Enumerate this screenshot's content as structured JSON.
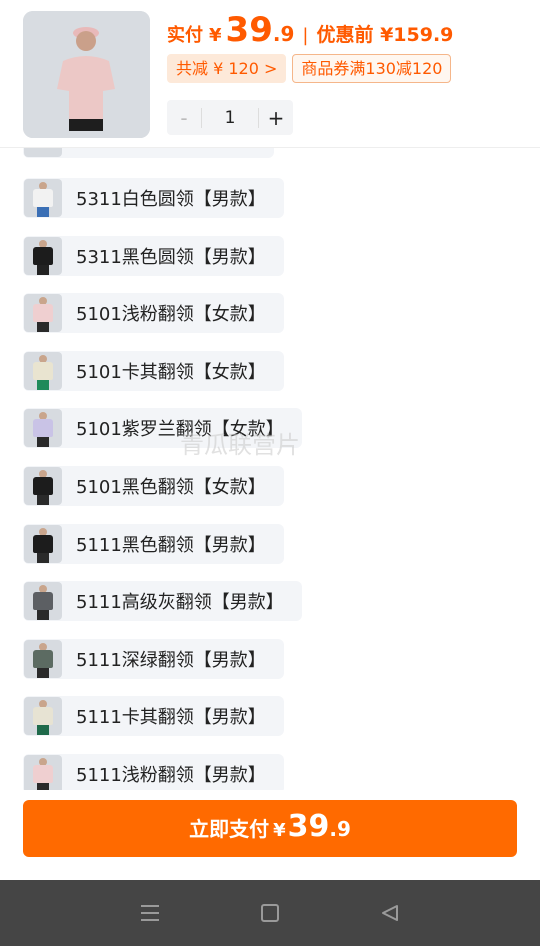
{
  "header": {
    "price_label": "实付",
    "currency": "¥",
    "price_int": "39",
    "price_dec": ".9",
    "separator": "|",
    "original_label": "优惠前 ¥159.9",
    "discount_tag": "共减 ¥ 120 >",
    "coupon_tag": "商品券满130减120",
    "quantity": {
      "minus": "-",
      "value": "1",
      "plus": "+"
    }
  },
  "options": [
    {
      "label": "5311白色圆领【男款】",
      "shirt": "#f2f2f2",
      "legs": "#3b6fb5"
    },
    {
      "label": "5311黑色圆领【男款】",
      "shirt": "#1c1c1c",
      "legs": "#222222"
    },
    {
      "label": "5101浅粉翻领【女款】",
      "shirt": "#efcfd0",
      "legs": "#2a2a2a"
    },
    {
      "label": "5101卡其翻领【女款】",
      "shirt": "#e9e4d0",
      "legs": "#1f8a5a"
    },
    {
      "label": "5101紫罗兰翻领【女款】",
      "shirt": "#c9c3e6",
      "legs": "#2a2a2a"
    },
    {
      "label": "5101黑色翻领【女款】",
      "shirt": "#1c1c1c",
      "legs": "#2a2a2a"
    },
    {
      "label": "5111黑色翻领【男款】",
      "shirt": "#1c1c1c",
      "legs": "#2a2a2a"
    },
    {
      "label": "5111高级灰翻领【男款】",
      "shirt": "#5c5f63",
      "legs": "#2a2a2a"
    },
    {
      "label": "5111深绿翻领【男款】",
      "shirt": "#5c6b62",
      "legs": "#2a2a2a"
    },
    {
      "label": "5111卡其翻领【男款】",
      "shirt": "#e7e3d3",
      "legs": "#1f6a4a"
    },
    {
      "label": "5111浅粉翻领【男款】",
      "shirt": "#efcfd0",
      "legs": "#2a2a2a"
    }
  ],
  "watermark": "青瓜联营片",
  "pay_button": {
    "label": "立即支付",
    "currency": "¥",
    "int": "39",
    "dec": ".9"
  },
  "colors": {
    "accent": "#ff6a00",
    "price": "#ff5a00"
  }
}
